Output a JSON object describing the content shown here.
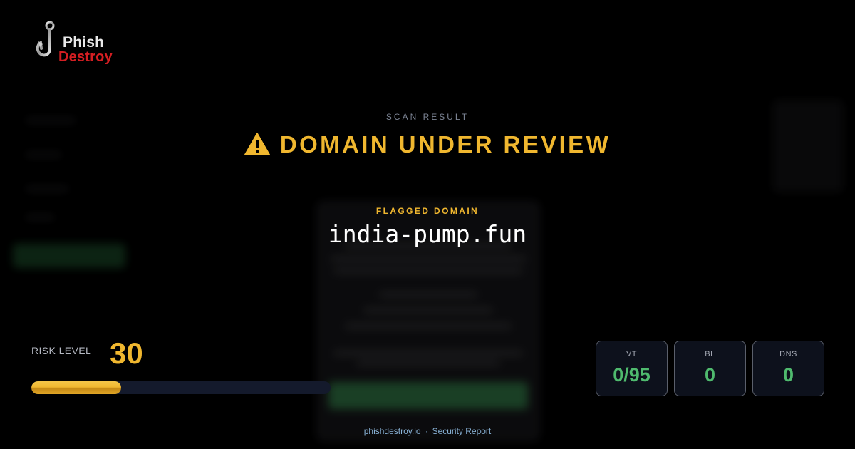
{
  "brand": {
    "line1": "Phish",
    "line2": "Destroy"
  },
  "scan": {
    "label": "SCAN RESULT",
    "status": "DOMAIN UNDER REVIEW",
    "status_icon": "warning-triangle-icon"
  },
  "flagged": {
    "label": "FLAGGED DOMAIN",
    "domain": "india-pump.fun"
  },
  "risk": {
    "label": "RISK LEVEL",
    "value": "30",
    "fill_percent": 30
  },
  "stats": [
    {
      "key": "VT",
      "value": "0/95"
    },
    {
      "key": "BL",
      "value": "0"
    },
    {
      "key": "DNS",
      "value": "0"
    }
  ],
  "footer": {
    "site": "phishdestroy.io",
    "separator": "·",
    "report": "Security Report"
  },
  "colors": {
    "accent": "#f0b72f",
    "brand_red": "#d41e22",
    "good": "#4fba6e",
    "background": "#000000"
  }
}
